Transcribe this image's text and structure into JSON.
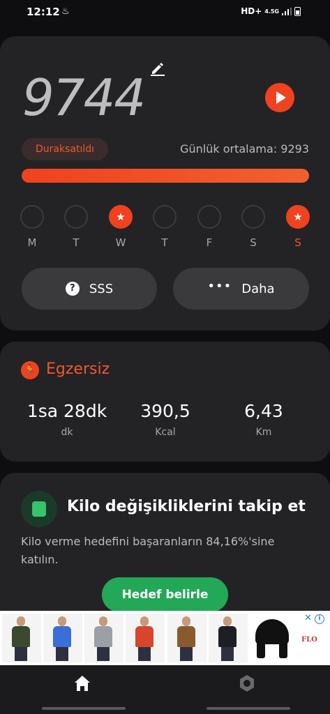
{
  "status_bar": {
    "time": "12:12",
    "network": "HD+",
    "network_sub": "4.5G"
  },
  "steps_card": {
    "steps": "9744",
    "paused_label": "Duraksatıldı",
    "daily_average": "Günlük ortalama: 9293",
    "progress": 1.0,
    "days": [
      {
        "label": "M",
        "done": false
      },
      {
        "label": "T",
        "done": false
      },
      {
        "label": "W",
        "done": true
      },
      {
        "label": "T",
        "done": false
      },
      {
        "label": "F",
        "done": false
      },
      {
        "label": "S",
        "done": false
      },
      {
        "label": "S",
        "done": true,
        "today": true
      }
    ],
    "faq_label": "SSS",
    "more_label": "Daha"
  },
  "exercise_card": {
    "title": "Egzersiz",
    "stats": [
      {
        "value": "1sa 28dk",
        "unit": "dk"
      },
      {
        "value": "390,5",
        "unit": "Kcal"
      },
      {
        "value": "6,43",
        "unit": "Km"
      }
    ]
  },
  "weight_card": {
    "title": "Kilo değişikliklerini takip et",
    "description": "Kilo verme hedefini başaranların 84,16%'sine katılın.",
    "goal_button": "Hedef belirle"
  },
  "ad": {
    "brand": "FLO",
    "product_colors": [
      "#3b4a2f",
      "#3a6fd8",
      "#9aa0a6",
      "#d8452b",
      "#8a5a2e",
      "#1e1f24"
    ]
  },
  "colors": {
    "accent": "#f0421f",
    "green": "#23a857",
    "card": "#232326"
  }
}
